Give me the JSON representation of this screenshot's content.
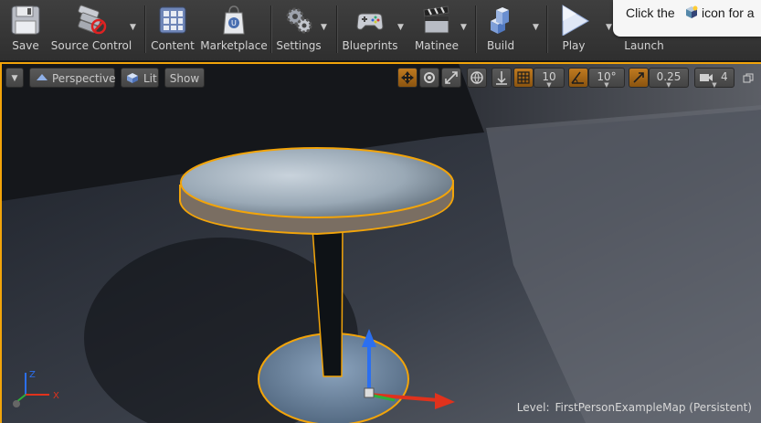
{
  "toolbar": {
    "buttons": [
      {
        "label": "Save",
        "icon": "save-icon"
      },
      {
        "label": "Source Control",
        "icon": "source-control-icon"
      },
      {
        "label": "Content",
        "icon": "content-icon"
      },
      {
        "label": "Marketplace",
        "icon": "marketplace-icon"
      },
      {
        "label": "Settings",
        "icon": "settings-icon"
      },
      {
        "label": "Blueprints",
        "icon": "blueprints-icon"
      },
      {
        "label": "Matinee",
        "icon": "matinee-icon"
      },
      {
        "label": "Build",
        "icon": "build-icon"
      },
      {
        "label": "Play",
        "icon": "play-icon"
      },
      {
        "label": "Launch",
        "icon": "launch-icon"
      }
    ]
  },
  "tooltip": {
    "text_before": "Click the",
    "text_after": "icon for a"
  },
  "viewport": {
    "perspective_label": "Perspective",
    "lit_label": "Lit",
    "show_label": "Show",
    "grid_snap_value": "10",
    "rotation_snap_value": "10°",
    "scale_snap_value": "0.25",
    "camera_speed_value": "4",
    "level_label": "Level:",
    "level_name": "FirstPersonExampleMap (Persistent)",
    "selection_color": "#f2a40a",
    "axis_labels": {
      "x": "X",
      "z": "Z"
    }
  }
}
